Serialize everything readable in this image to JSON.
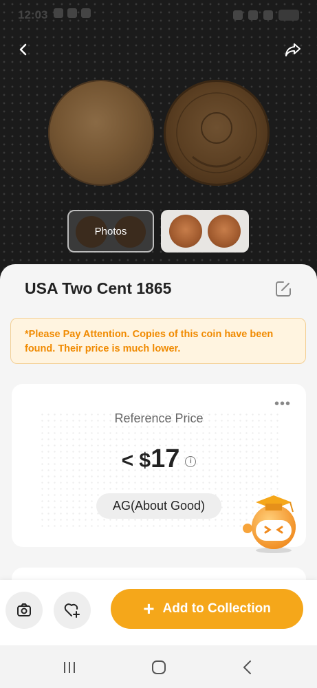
{
  "status_bar": {
    "time": "12:03"
  },
  "header": {
    "back_icon": "chevron-left-icon",
    "share_icon": "share-icon"
  },
  "gallery": {
    "photos_label": "Photos"
  },
  "coin": {
    "title": "USA Two Cent 1865"
  },
  "notice": {
    "text": "*Please Pay Attention. Copies of this coin have been found. Their price is much lower."
  },
  "price_card": {
    "label": "Reference Price",
    "prefix": "< $",
    "amount": "17",
    "grade": "AG(About Good)",
    "more": "•••"
  },
  "actions": {
    "add_label": "Add to Collection",
    "camera_icon": "camera-icon",
    "favorite_icon": "heart-plus-icon"
  },
  "colors": {
    "accent": "#f5a71a",
    "notice_text": "#f08a00",
    "notice_bg": "#fff4e0"
  }
}
